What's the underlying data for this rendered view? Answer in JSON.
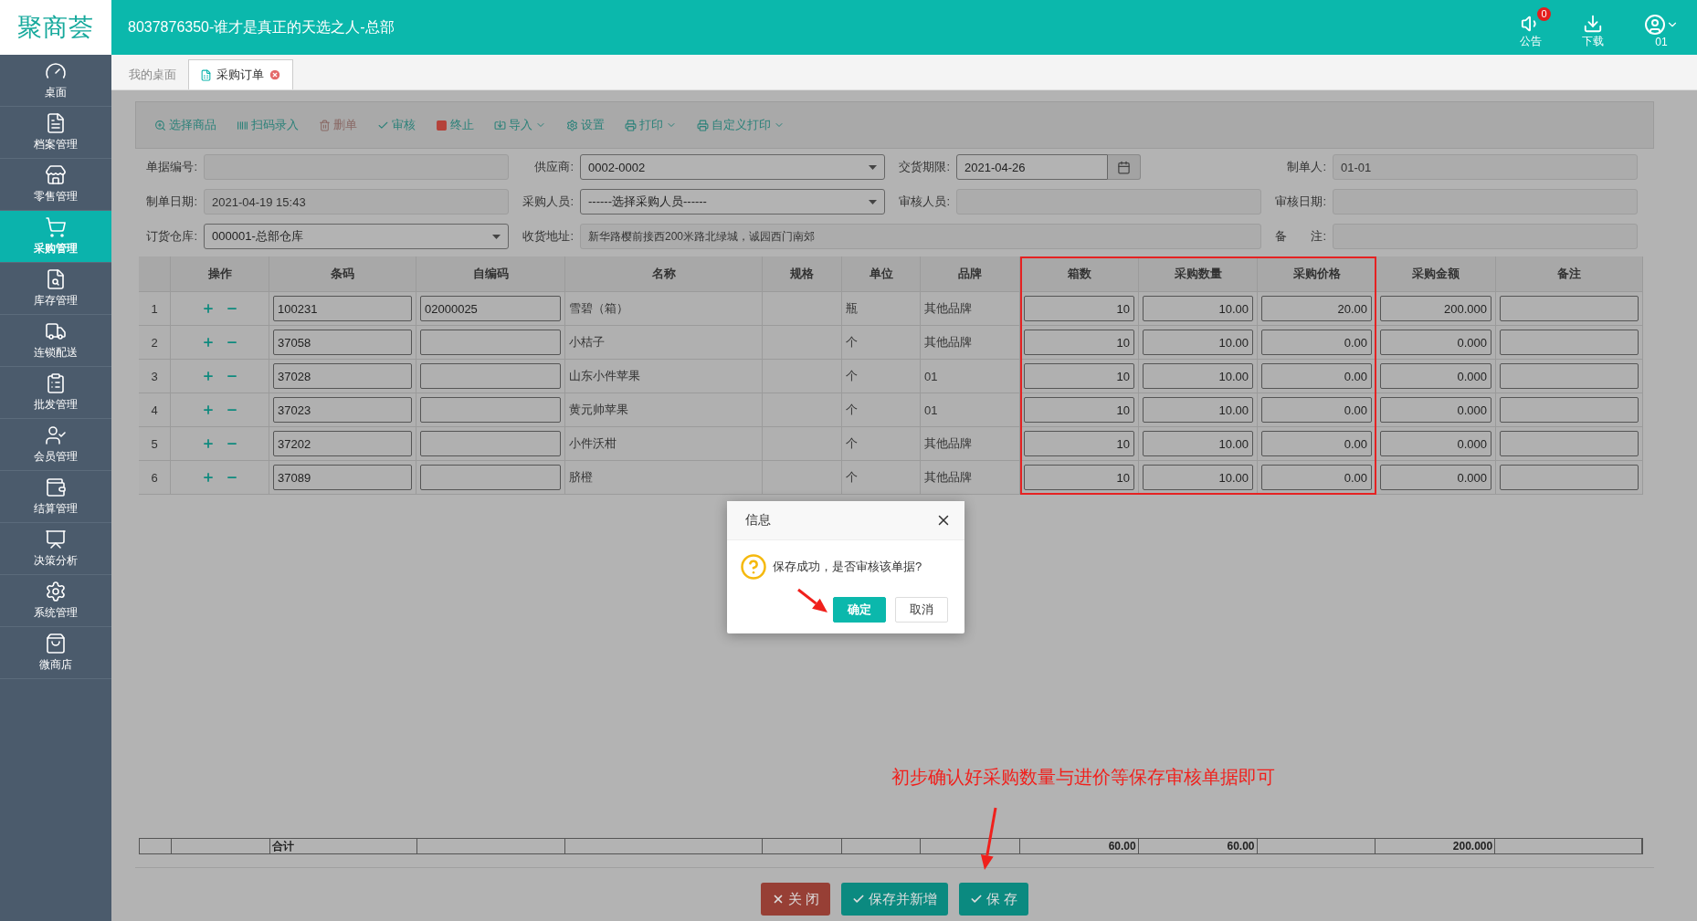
{
  "header": {
    "logo": "聚商荟",
    "title": "8037876350-谁才是真正的天选之人-总部",
    "actions": [
      {
        "label": "公告",
        "badge": "0"
      },
      {
        "label": "下载"
      }
    ],
    "user": "01"
  },
  "sidebar": {
    "items": [
      {
        "label": "桌面",
        "selected": false
      },
      {
        "label": "档案管理",
        "selected": false
      },
      {
        "label": "零售管理",
        "selected": false
      },
      {
        "label": "采购管理",
        "selected": true
      },
      {
        "label": "库存管理",
        "selected": false
      },
      {
        "label": "连锁配送",
        "selected": false
      },
      {
        "label": "批发管理",
        "selected": false
      },
      {
        "label": "会员管理",
        "selected": false
      },
      {
        "label": "结算管理",
        "selected": false
      },
      {
        "label": "决策分析",
        "selected": false
      },
      {
        "label": "系统管理",
        "selected": false
      },
      {
        "label": "微商店",
        "selected": false
      }
    ]
  },
  "tabs": [
    {
      "label": "我的桌面",
      "selected": false,
      "closable": false
    },
    {
      "label": "采购订单",
      "selected": true,
      "closable": true
    }
  ],
  "toolbar": [
    {
      "label": "选择商品",
      "dropdown": false
    },
    {
      "label": "扫码录入",
      "dropdown": false
    },
    {
      "label": "删单",
      "dropdown": false
    },
    {
      "label": "审核",
      "dropdown": false
    },
    {
      "label": "终止",
      "dropdown": false
    },
    {
      "label": "导入",
      "dropdown": true
    },
    {
      "label": "设置",
      "dropdown": false
    },
    {
      "label": "打印",
      "dropdown": true
    },
    {
      "label": "自定义打印",
      "dropdown": true
    }
  ],
  "form": [
    {
      "label": "单据编号:",
      "kind": "text",
      "disabled": true
    },
    {
      "label": "供应商:",
      "kind": "select",
      "value": "0002-0002",
      "disabled": false
    },
    {
      "label": "交货期限:",
      "kind": "date",
      "value": "2021-04-26",
      "disabled": false
    },
    {
      "label": "制单人:",
      "kind": "text",
      "value": "01-01",
      "disabled": true
    },
    {
      "label": "制单日期:",
      "kind": "text",
      "value": "2021-04-19 15:43",
      "disabled": true
    },
    {
      "label": "采购人员:",
      "kind": "select",
      "value": "------选择采购人员------",
      "disabled": false
    },
    {
      "label": "审核人员:",
      "kind": "text",
      "disabled": true
    },
    {
      "label": "审核日期:",
      "kind": "text",
      "disabled": true
    },
    {
      "label": "订货仓库:",
      "kind": "select",
      "value": "000001-总部仓库",
      "disabled": false
    },
    {
      "label": "收货地址:",
      "kind": "wide",
      "value": "新华路樱前接西200米路北绿城，诚园西门南郊",
      "disabled": true
    },
    {
      "label": "备　　注:",
      "kind": "text",
      "disabled": true
    }
  ],
  "table": {
    "columns": [
      {
        "kind": "index",
        "highlighted": false
      },
      {
        "label": "操作",
        "kind": "actions",
        "highlighted": false
      },
      {
        "label": "条码",
        "kind": "input",
        "highlighted": false
      },
      {
        "label": "自编码",
        "kind": "input",
        "highlighted": false
      },
      {
        "label": "名称",
        "kind": "text",
        "highlighted": false
      },
      {
        "label": "规格",
        "kind": "text",
        "highlighted": false
      },
      {
        "label": "单位",
        "kind": "text",
        "highlighted": false
      },
      {
        "label": "品牌",
        "kind": "text",
        "highlighted": false
      },
      {
        "label": "箱数",
        "kind": "number",
        "highlighted": true
      },
      {
        "label": "采购数量",
        "kind": "number",
        "highlighted": true
      },
      {
        "label": "采购价格",
        "kind": "number",
        "highlighted": true
      },
      {
        "label": "采购金额",
        "kind": "number",
        "highlighted": false
      },
      {
        "label": "备注",
        "kind": "input",
        "highlighted": false
      }
    ],
    "rows": [
      {
        "index": "1",
        "barcode": "100231",
        "code": "02000025",
        "name": "雪碧（箱）",
        "unit": "瓶",
        "brand": "其他品牌",
        "boxes": "10",
        "qty": "10.00",
        "price": "20.00",
        "amount": "200.000"
      },
      {
        "index": "2",
        "barcode": "37058",
        "name": "小桔子",
        "unit": "个",
        "brand": "其他品牌",
        "boxes": "10",
        "qty": "10.00",
        "price": "0.00",
        "amount": "0.000"
      },
      {
        "index": "3",
        "barcode": "37028",
        "name": "山东小件苹果",
        "unit": "个",
        "brand": "01",
        "boxes": "10",
        "qty": "10.00",
        "price": "0.00",
        "amount": "0.000"
      },
      {
        "index": "4",
        "barcode": "37023",
        "name": "黄元帅苹果",
        "unit": "个",
        "brand": "01",
        "boxes": "10",
        "qty": "10.00",
        "price": "0.00",
        "amount": "0.000"
      },
      {
        "index": "5",
        "barcode": "37202",
        "name": "小件沃柑",
        "unit": "个",
        "brand": "其他品牌",
        "boxes": "10",
        "qty": "10.00",
        "price": "0.00",
        "amount": "0.000"
      },
      {
        "index": "6",
        "barcode": "37089",
        "name": "脐橙",
        "unit": "个",
        "brand": "其他品牌",
        "boxes": "10",
        "qty": "10.00",
        "price": "0.00",
        "amount": "0.000"
      }
    ],
    "totals": {
      "barcode": "合计",
      "boxes": "60.00",
      "qty": "60.00",
      "amount": "200.000"
    }
  },
  "footer_buttons": [
    {
      "label": "关 闭",
      "kind": "danger"
    },
    {
      "label": "保存并新增",
      "kind": "primary"
    },
    {
      "label": "保 存",
      "kind": "primary"
    }
  ],
  "dialog": {
    "title": "信息",
    "message": "保存成功，是否审核该单据?",
    "buttons": [
      {
        "label": "确定",
        "kind": "primary"
      },
      {
        "label": "取消",
        "kind": "default"
      }
    ]
  },
  "annotation": {
    "text": "初步确认好采购数量与进价等保存审核单据即可"
  }
}
